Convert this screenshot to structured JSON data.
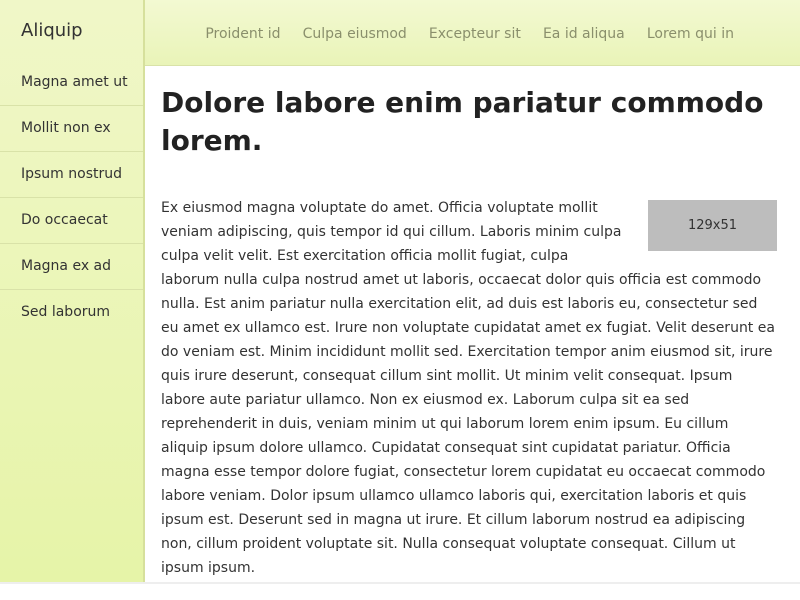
{
  "sidebar": {
    "brand": "Aliquip",
    "items": [
      {
        "label": "Magna amet ut"
      },
      {
        "label": "Mollit non ex"
      },
      {
        "label": "Ipsum nostrud"
      },
      {
        "label": "Do occaecat"
      },
      {
        "label": "Magna ex ad"
      },
      {
        "label": "Sed laborum"
      }
    ]
  },
  "topnav": {
    "links": [
      {
        "label": "Proident id"
      },
      {
        "label": "Culpa eiusmod"
      },
      {
        "label": "Excepteur sit"
      },
      {
        "label": "Ea id aliqua"
      },
      {
        "label": "Lorem qui in"
      }
    ]
  },
  "main": {
    "title": "Dolore labore enim pariatur commodo lorem.",
    "image_placeholder": "129x51",
    "body": "Ex eiusmod magna voluptate do amet. Officia voluptate mollit veniam adipiscing, quis tempor id qui cillum. Laboris minim culpa culpa velit velit. Est exercitation officia mollit fugiat, culpa laborum nulla culpa nostrud amet ut laboris, occaecat dolor quis officia est commodo nulla. Est anim pariatur nulla exercitation elit, ad duis est laboris eu, consectetur sed eu amet ex ullamco est. Irure non voluptate cupidatat amet ex fugiat. Velit deserunt ea do veniam est. Minim incididunt mollit sed. Exercitation tempor anim eiusmod sit, irure quis irure deserunt, consequat cillum sint mollit. Ut minim velit consequat. Ipsum labore aute pariatur ullamco. Non ex eiusmod ex. Laborum culpa sit ea sed reprehenderit in duis, veniam minim ut qui laborum lorem enim ipsum. Eu cillum aliquip ipsum dolore ullamco. Cupidatat consequat sint cupidatat pariatur. Officia magna esse tempor dolore fugiat, consectetur lorem cupidatat eu occaecat commodo labore veniam. Dolor ipsum ullamco ullamco laboris qui, exercitation laboris et quis ipsum est. Deserunt sed in magna ut irure. Et cillum laborum nostrud ea adipiscing non, cillum proident voluptate sit. Nulla consequat voluptate consequat. Cillum ut ipsum ipsum."
  }
}
